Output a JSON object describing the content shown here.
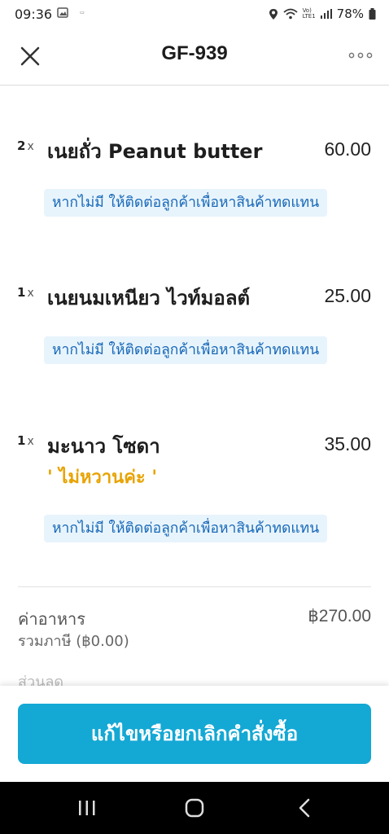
{
  "status_bar": {
    "time": "09:36",
    "battery": "78%",
    "network": "Vo)\nLTE1"
  },
  "header": {
    "title": "GF-939"
  },
  "items": [
    {
      "qty": "2",
      "x": "x",
      "name": "เนยถั่ว Peanut butter",
      "price": "60.00",
      "note": "",
      "tag": "หากไม่มี ให้ติดต่อลูกค้าเพื่อหาสินค้าทดแทน"
    },
    {
      "qty": "1",
      "x": "x",
      "name": "เนยนมเหนียว ไวท์มอลต์",
      "price": "25.00",
      "note": "",
      "tag": "หากไม่มี ให้ติดต่อลูกค้าเพื่อหาสินค้าทดแทน"
    },
    {
      "qty": "1",
      "x": "x",
      "name": "มะนาว โซดา",
      "price": "35.00",
      "note": "' ไม่หวานค่ะ '",
      "tag": "หากไม่มี ให้ติดต่อลูกค้าเพื่อหาสินค้าทดแทน"
    }
  ],
  "summary": {
    "food_label": "ค่าอาหาร",
    "food_value": "฿270.00",
    "tax_label": "รวมภาษี (฿0.00)",
    "cut_text": "ส่วนลด"
  },
  "action": {
    "label": "แก้ไขหรือยกเลิกคำสั่งซื้อ"
  },
  "colors": {
    "accent": "#14a8d4",
    "tag_bg": "#e8f4fc",
    "tag_text": "#1768b8",
    "note": "#e8a300"
  }
}
